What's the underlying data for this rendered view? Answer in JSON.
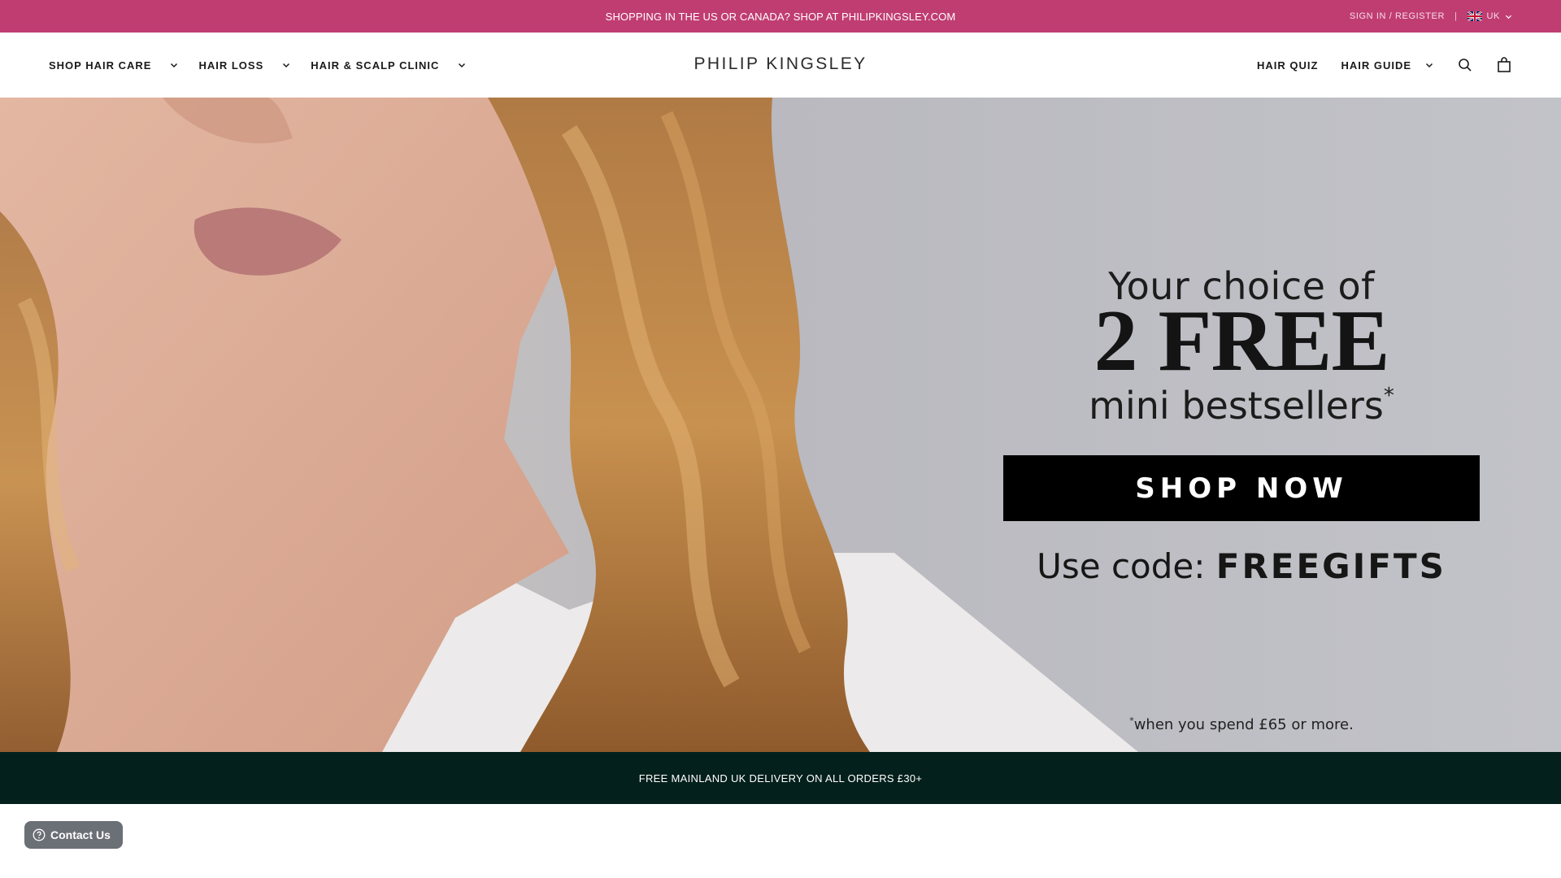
{
  "announcement": {
    "message": "SHOPPING IN THE US OR CANADA? SHOP AT PHILIPKINGSLEY.COM",
    "sign_in": "SIGN IN / REGISTER",
    "separator": "|",
    "country": "UK"
  },
  "header": {
    "logo_text": "PHILIP KINGSLEY",
    "nav_left": [
      {
        "label": "SHOP HAIR CARE"
      },
      {
        "label": "HAIR LOSS"
      },
      {
        "label": "HAIR & SCALP CLINIC"
      }
    ],
    "nav_right": [
      {
        "label": "HAIR QUIZ"
      },
      {
        "label": "HAIR GUIDE"
      }
    ]
  },
  "hero": {
    "line1": "Your choice of",
    "line2": "2 FREE",
    "line3": "mini bestsellers",
    "line3_mark": "*",
    "cta_label": "SHOP NOW",
    "code_prefix": "Use code: ",
    "code": "FREEGIFTS",
    "footnote_mark": "*",
    "footnote": "when you spend £65 or more."
  },
  "delivery_bar": {
    "text": "FREE MAINLAND UK DELIVERY ON ALL ORDERS £30+"
  },
  "contact": {
    "label": "Contact Us"
  },
  "colors": {
    "announcement_bg": "#c03d72",
    "delivery_bg": "#04201c",
    "cta_bg": "#000000",
    "contact_bg": "#6b6f76"
  },
  "icons": [
    "chevron-down-icon",
    "search-icon",
    "bag-icon",
    "uk-flag-icon",
    "help-icon"
  ]
}
